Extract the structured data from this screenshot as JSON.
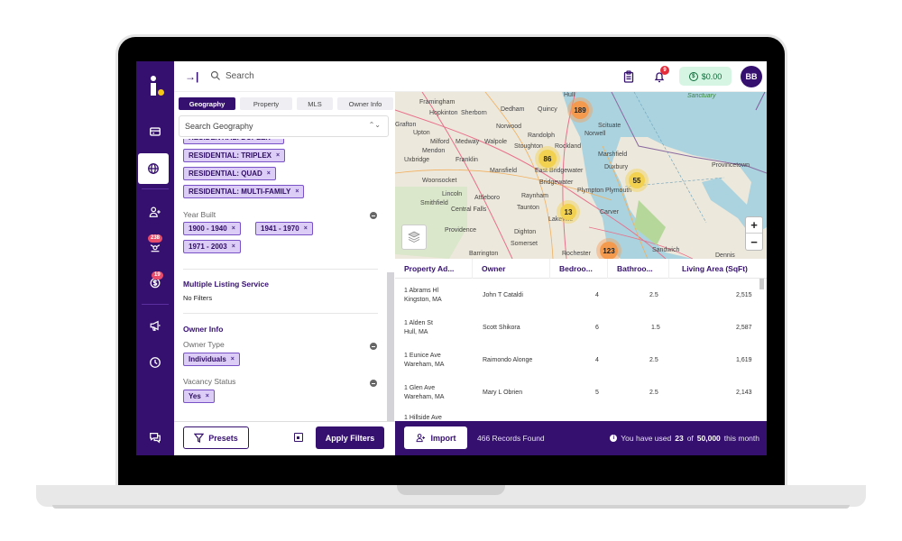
{
  "topbar": {
    "collapse_icon": "→|",
    "search_placeholder": "Search",
    "notification_count": "9",
    "balance": "$0.00",
    "avatar_initials": "BB"
  },
  "rail": {
    "badges": {
      "leads": "238",
      "deals": "19"
    }
  },
  "filters": {
    "tabs": [
      {
        "label": "Geography",
        "active": true
      },
      {
        "label": "Property",
        "active": false
      },
      {
        "label": "MLS",
        "active": false
      },
      {
        "label": "Owner Info",
        "active": false
      }
    ],
    "geo_search_placeholder": "Search Geography",
    "property_type_chips": [
      "RESIDENTIAL: DUPLEX",
      "RESIDENTIAL: TRIPLEX",
      "RESIDENTIAL: QUAD",
      "RESIDENTIAL: MULTI-FAMILY"
    ],
    "year_built": {
      "label": "Year Built",
      "chips": [
        "1900 - 1940",
        "1941 - 1970",
        "1971 - 2003"
      ]
    },
    "mls": {
      "title": "Multiple Listing Service",
      "value": "No Filters"
    },
    "owner_info": {
      "title": "Owner Info",
      "owner_type_label": "Owner Type",
      "owner_type_chips": [
        "Individuals"
      ],
      "vacancy_label": "Vacancy Status",
      "vacancy_chips": [
        "Yes"
      ]
    },
    "chip_remove": "×",
    "presets_label": "Presets",
    "apply_label": "Apply Filters"
  },
  "map": {
    "labels": [
      "Framingham",
      "Hopkinton",
      "Sherborn",
      "Dedham",
      "Quincy",
      "Hull",
      "Grafton",
      "Upton",
      "Norwood",
      "Milford",
      "Medway",
      "Walpole",
      "Randolph",
      "Stoughton",
      "Rockland",
      "Mendon",
      "Uxbridge",
      "Franklin",
      "Mansfield",
      "East Bridgewater",
      "Bridgewater",
      "Woonsocket",
      "Lincoln",
      "Attleboro",
      "Raynham",
      "Smithfield",
      "Central Falls",
      "Taunton",
      "Lakeville",
      "Providence",
      "Dighton",
      "Somerset",
      "Barrington",
      "Rochester",
      "Scituate",
      "Norwell",
      "Marshfield",
      "Duxbury",
      "Plympton",
      "Plymouth",
      "Carver",
      "Sandwich",
      "Dennis",
      "Provincetown",
      "Sanctuary"
    ],
    "clusters": [
      {
        "count": "189",
        "level": "high"
      },
      {
        "count": "86",
        "level": "mid"
      },
      {
        "count": "55",
        "level": "mid"
      },
      {
        "count": "13",
        "level": "mid"
      },
      {
        "count": "123",
        "level": "high"
      }
    ],
    "zoom_in": "+",
    "zoom_out": "−"
  },
  "table": {
    "columns": [
      "Property Ad...",
      "Owner",
      "Bedroo...",
      "Bathroo...",
      "Living Area (SqFt)"
    ],
    "rows": [
      {
        "street": "1 Abrams Hl",
        "city": "Kingston, MA",
        "owner": "John T Cataldi",
        "bedrooms": "4",
        "bathrooms": "2.5",
        "area": "2,515"
      },
      {
        "street": "1 Alden St",
        "city": "Hull, MA",
        "owner": "Scott Shikora",
        "bedrooms": "6",
        "bathrooms": "1.5",
        "area": "2,587"
      },
      {
        "street": "1 Eunice Ave",
        "city": "Wareham, MA",
        "owner": "Raimondo Alonge",
        "bedrooms": "4",
        "bathrooms": "2.5",
        "area": "1,619"
      },
      {
        "street": "1 Glen Ave",
        "city": "Wareham, MA",
        "owner": "Mary L Obrien",
        "bedrooms": "5",
        "bathrooms": "2.5",
        "area": "2,143"
      },
      {
        "street": "1 Hillside Ave",
        "city": "",
        "owner": "",
        "bedrooms": "",
        "bathrooms": "",
        "area": ""
      }
    ]
  },
  "status": {
    "import_label": "Import",
    "records_found": "466 Records Found",
    "usage_prefix": "You have used",
    "usage_used": "23",
    "usage_of": "of",
    "usage_limit": "50,000",
    "usage_suffix": "this month"
  },
  "colors": {
    "brand": "#35106f",
    "chip_bg": "#dccdf7",
    "cluster_high": "#f49a4e",
    "cluster_mid": "#f1d14f",
    "balance_bg": "#d6f5e2"
  }
}
